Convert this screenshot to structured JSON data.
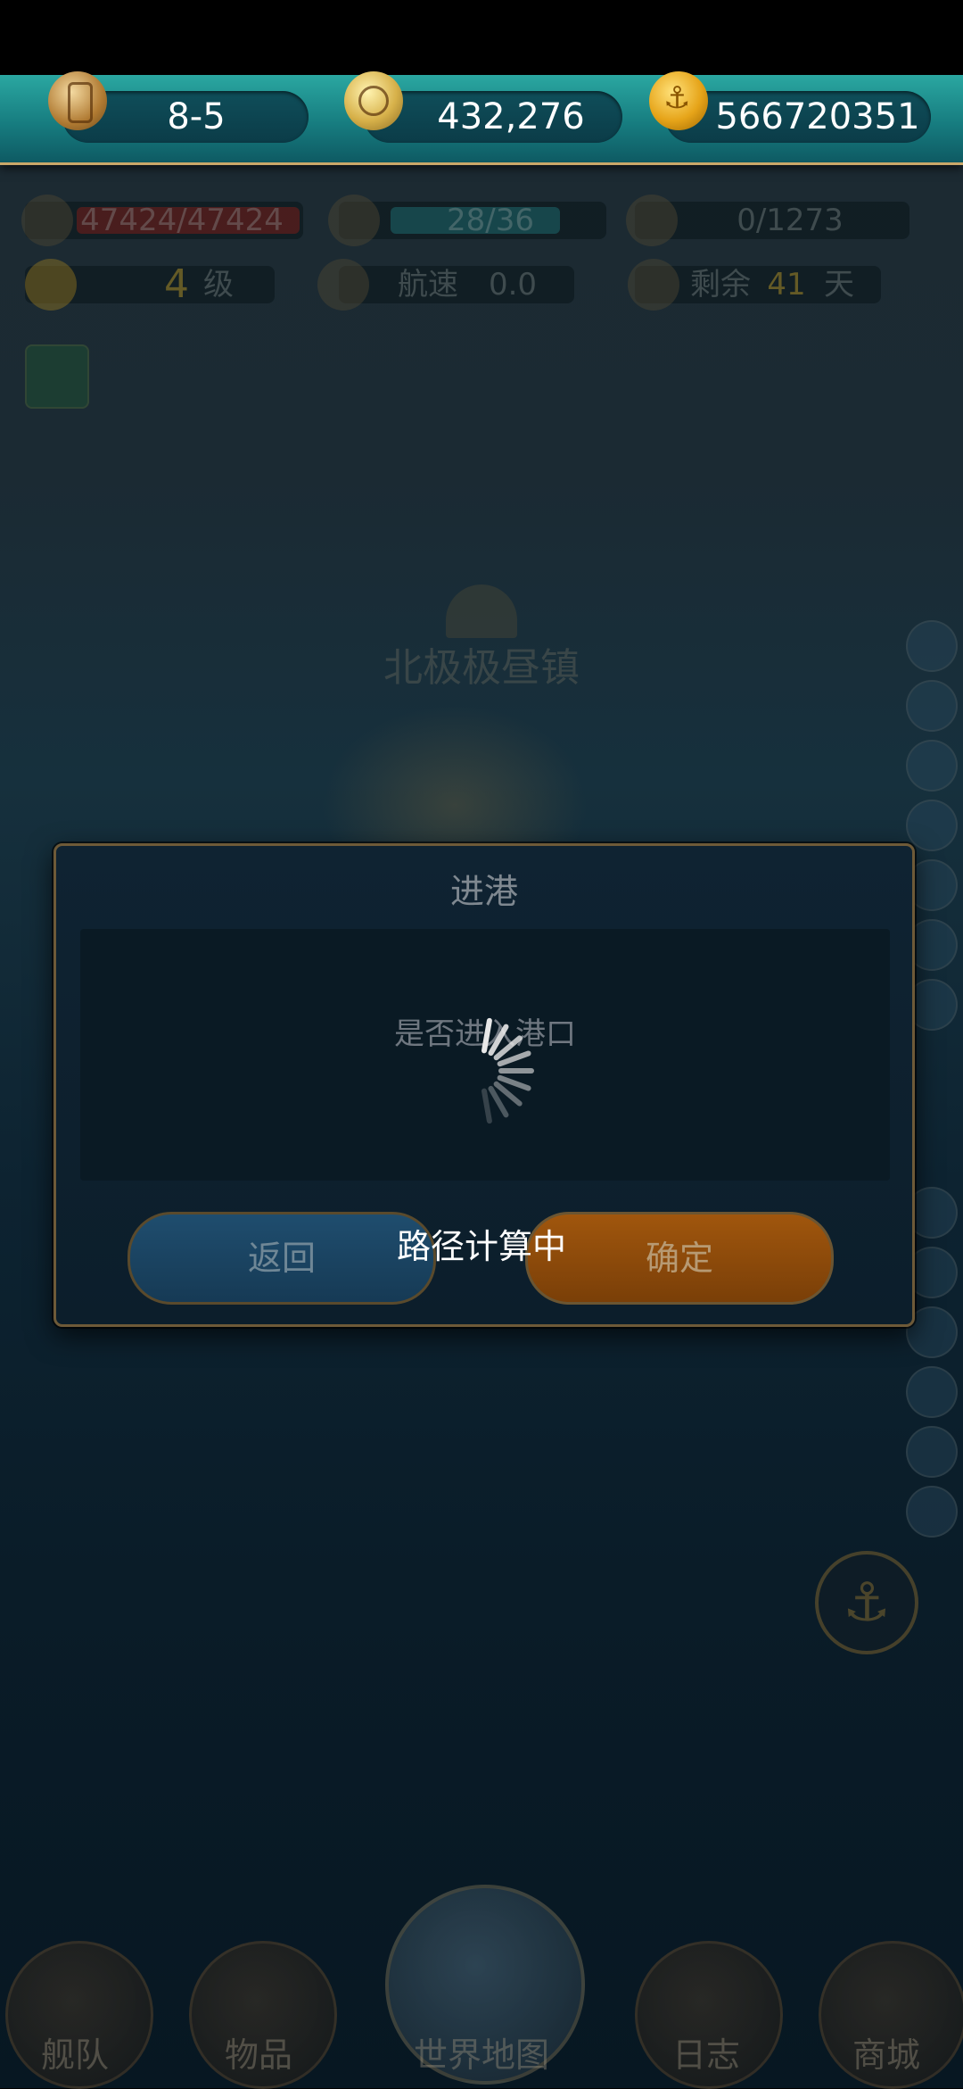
{
  "topbar": {
    "level": "8-5",
    "compass_value": "432,276",
    "gold": "566720351"
  },
  "hud": {
    "hp": "47424/47424",
    "crew": "28/36",
    "cargo": "0/1273",
    "rank_value": "4",
    "rank_unit": "级",
    "speed_label": "航速",
    "speed_value": "0.0",
    "remaining_label": "剩余",
    "remaining_value": "41",
    "remaining_unit": "天"
  },
  "port_name": "北极极昼镇",
  "dialog": {
    "title": "进港",
    "message": "是否进入港口",
    "back_label": "返回",
    "confirm_label": "确定"
  },
  "loading_text": "路径计算中",
  "nav": {
    "fleet": "舰队",
    "items": "物品",
    "world_map": "世界地图",
    "log": "日志",
    "shop": "商城"
  }
}
